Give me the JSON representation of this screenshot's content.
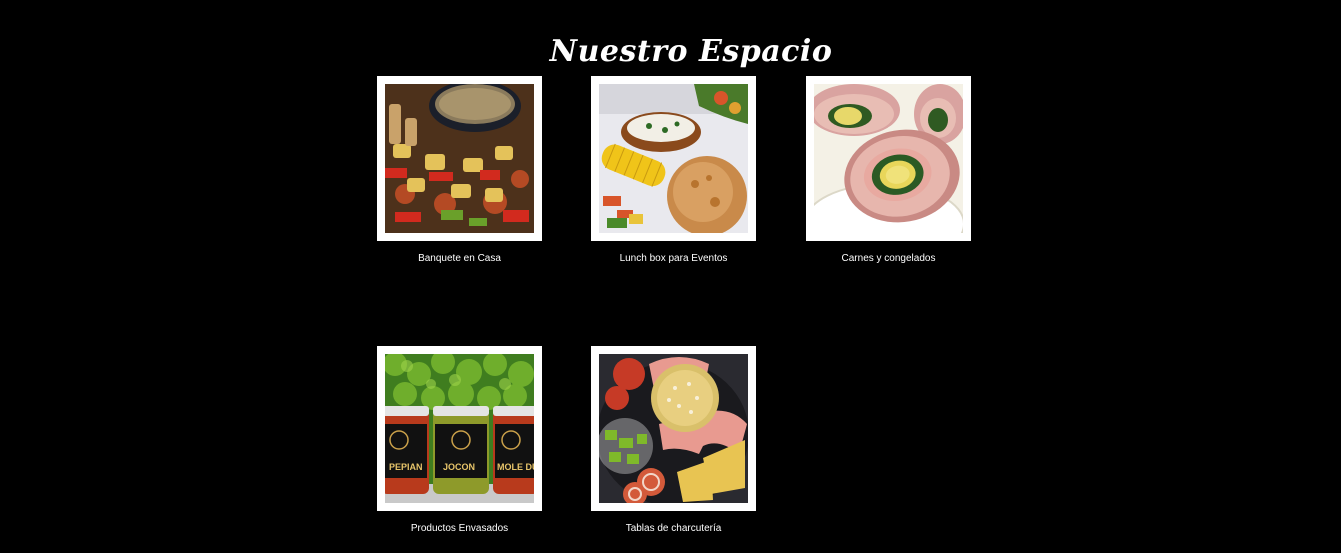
{
  "section": {
    "title": "Nuestro Espacio"
  },
  "gallery": {
    "items": [
      {
        "caption": "Banquete en Casa",
        "image": "grilled-skewers-photo"
      },
      {
        "caption": "Lunch box para Eventos",
        "image": "lunch-box-photo"
      },
      {
        "caption": "Carnes y congelados",
        "image": "stuffed-meat-rolls-photo"
      },
      {
        "caption": "Productos Envasados",
        "image": "jarred-sauces-photo"
      },
      {
        "caption": "Tablas de charcutería",
        "image": "charcuterie-board-photo"
      }
    ],
    "jar_labels": [
      "PEPIAN",
      "JOCON",
      "MOLE DU"
    ]
  },
  "colors": {
    "background": "#000000",
    "frame": "#ffffff",
    "text": "#ffffff"
  }
}
